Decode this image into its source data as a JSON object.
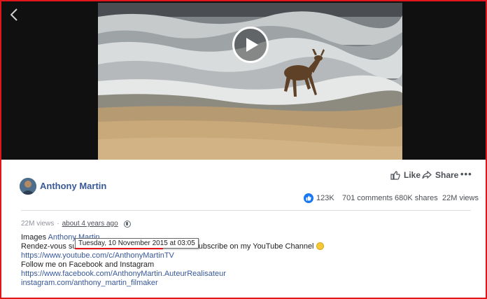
{
  "post": {
    "author": "Anthony Martin",
    "actions": {
      "like": "Like",
      "share": "Share",
      "more": "•••"
    },
    "stats": {
      "reactions": "123K",
      "comments": "701 comments",
      "shares": "680K shares",
      "views": "22M views"
    },
    "meta": {
      "views": "22M views",
      "separator": "·",
      "time": "about 4 years ago"
    },
    "tooltip": "Tuesday, 10 November 2015 at 03:05",
    "description": {
      "line1_prefix": "Images ",
      "line1_link": "Anthony Martin",
      "line2_start": "Rendez-vous sur",
      "line2_end": "nature. Subscribe on my YouTube Channel",
      "line3_link": "https://www.youtube.com/c/AnthonyMartinTV",
      "line4": "Follow me on Facebook and Instagram",
      "line5_link": "https://www.facebook.com/AnthonyMartin.AuteurRealisateur",
      "line6_link": "instagram.com/anthony_martin_filmaker"
    }
  },
  "colors": {
    "accent": "#385898",
    "frame": "#e0161b",
    "reaction_blue": "#1877f2"
  }
}
